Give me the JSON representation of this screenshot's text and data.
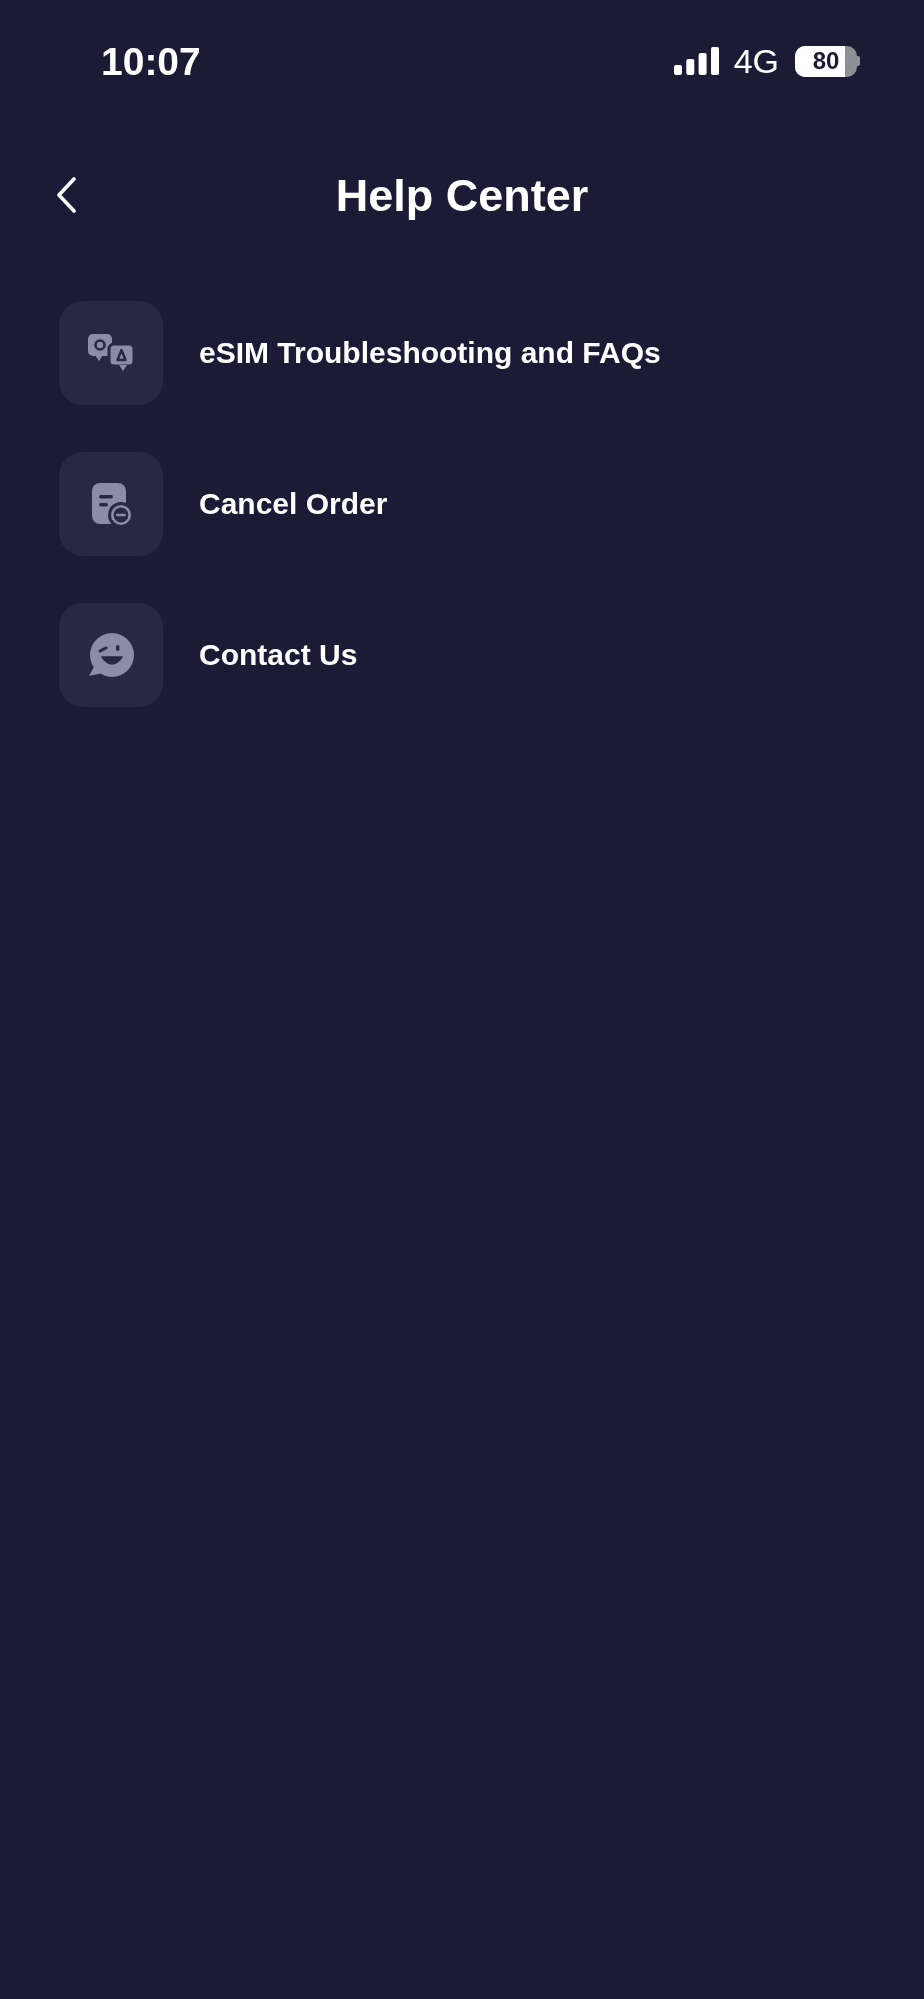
{
  "status_bar": {
    "time": "10:07",
    "network": "4G",
    "battery": {
      "percentage": "80",
      "level": 0.8
    }
  },
  "header": {
    "title": "Help Center"
  },
  "menu": [
    {
      "label": "eSIM Troubleshooting and FAQs",
      "kind": "faq"
    },
    {
      "label": "Cancel Order",
      "kind": "cancel"
    },
    {
      "label": "Contact Us",
      "kind": "chat"
    }
  ]
}
